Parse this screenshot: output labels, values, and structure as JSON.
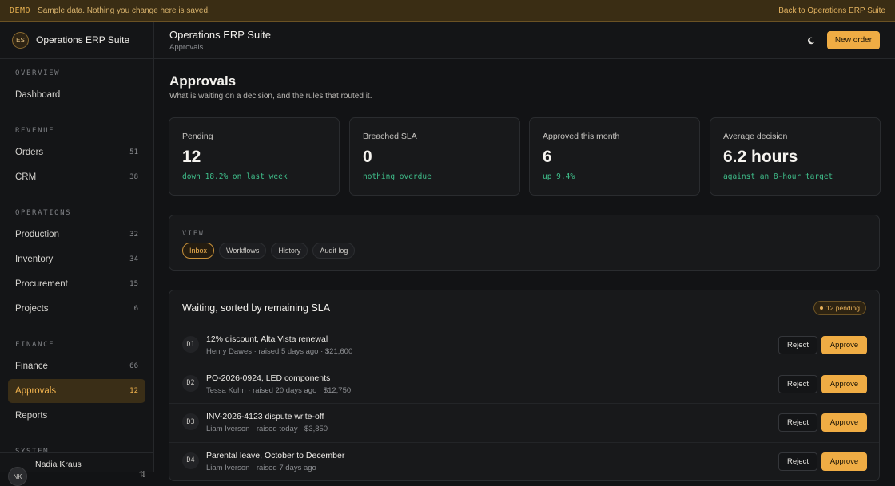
{
  "banner": {
    "tag": "DEMO",
    "text": "Sample data. Nothing you change here is saved.",
    "link": "Back to Operations ERP Suite"
  },
  "brand": {
    "initials": "ES",
    "name": "Operations ERP Suite"
  },
  "sidebar": {
    "sections": [
      {
        "label": "OVERVIEW",
        "items": [
          {
            "label": "Dashboard",
            "count": ""
          }
        ]
      },
      {
        "label": "REVENUE",
        "items": [
          {
            "label": "Orders",
            "count": "51"
          },
          {
            "label": "CRM",
            "count": "38"
          }
        ]
      },
      {
        "label": "OPERATIONS",
        "items": [
          {
            "label": "Production",
            "count": "32"
          },
          {
            "label": "Inventory",
            "count": "34"
          },
          {
            "label": "Procurement",
            "count": "15"
          },
          {
            "label": "Projects",
            "count": "6"
          }
        ]
      },
      {
        "label": "FINANCE",
        "items": [
          {
            "label": "Finance",
            "count": "66"
          },
          {
            "label": "Approvals",
            "count": "12",
            "active": true
          },
          {
            "label": "Reports",
            "count": ""
          }
        ]
      },
      {
        "label": "SYSTEM",
        "items": []
      }
    ],
    "user": {
      "initials": "NK",
      "name": "Nadia Kraus"
    }
  },
  "topbar": {
    "title": "Operations ERP Suite",
    "breadcrumb": "Approvals",
    "new_order": "New order"
  },
  "page": {
    "title": "Approvals",
    "subtitle": "What is waiting on a decision, and the rules that routed it."
  },
  "stats": [
    {
      "label": "Pending",
      "value": "12",
      "note": "down 18.2% on last week"
    },
    {
      "label": "Breached SLA",
      "value": "0",
      "note": "nothing overdue"
    },
    {
      "label": "Approved this month",
      "value": "6",
      "note": "up 9.4%"
    },
    {
      "label": "Average decision",
      "value": "6.2 hours",
      "note": "against an 8-hour target"
    }
  ],
  "view": {
    "label": "VIEW",
    "tabs": [
      {
        "label": "Inbox",
        "active": true
      },
      {
        "label": "Workflows"
      },
      {
        "label": "History"
      },
      {
        "label": "Audit log"
      }
    ]
  },
  "queue": {
    "title": "Waiting, sorted by remaining SLA",
    "badge": "12 pending",
    "reject_label": "Reject",
    "approve_label": "Approve",
    "rows": [
      {
        "id": "D1",
        "title": "12% discount, Alta Vista renewal",
        "meta": "Henry Dawes · raised 5 days ago · $21,600"
      },
      {
        "id": "D2",
        "title": "PO-2026-0924, LED components",
        "meta": "Tessa Kuhn · raised 20 days ago · $12,750"
      },
      {
        "id": "D3",
        "title": "INV-2026-4123 dispute write-off",
        "meta": "Liam Iverson · raised today · $3,850"
      },
      {
        "id": "D4",
        "title": "Parental leave, October to December",
        "meta": "Liam Iverson · raised 7 days ago"
      }
    ]
  },
  "colors": {
    "accent": "#efac44",
    "positive": "#3fbf8b",
    "banner_bg": "#3a2d14",
    "background": "#121315"
  }
}
